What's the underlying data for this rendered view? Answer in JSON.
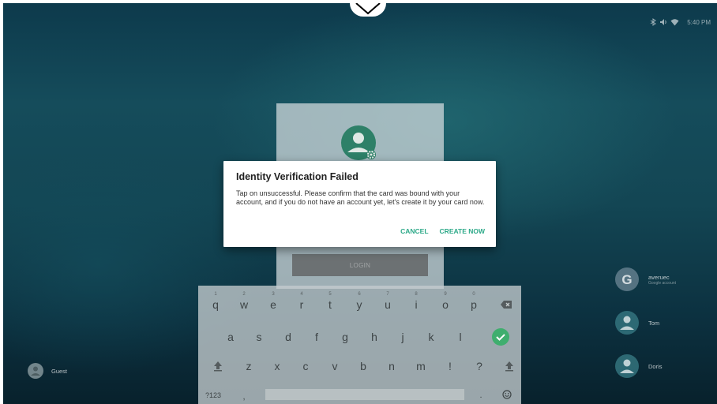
{
  "status_bar": {
    "time": "5:40 PM",
    "icons": [
      "bluetooth-icon",
      "volume-icon",
      "wifi-icon"
    ]
  },
  "login_card": {
    "login_label": "LOGIN"
  },
  "dialog": {
    "title": "Identity Verification Failed",
    "message": "Tap on unsuccessful. Please confirm that the card was bound with your account, and if you do not have an account yet, let's create it by your card now.",
    "cancel_label": "CANCEL",
    "create_label": "CREATE NOW"
  },
  "keyboard": {
    "row1": [
      "q",
      "w",
      "e",
      "r",
      "t",
      "y",
      "u",
      "i",
      "o",
      "p"
    ],
    "row1_hints": [
      "1",
      "2",
      "3",
      "4",
      "5",
      "6",
      "7",
      "8",
      "9",
      "0"
    ],
    "row2": [
      "a",
      "s",
      "d",
      "f",
      "g",
      "h",
      "j",
      "k",
      "l"
    ],
    "row3": [
      "z",
      "x",
      "c",
      "v",
      "b",
      "n",
      "m",
      "!",
      "?"
    ],
    "symbols_label": "?123",
    "comma_label": ",",
    "period_label": "."
  },
  "users": [
    {
      "name": "averuec",
      "subtitle": "Google account",
      "avatar": "google-icon"
    },
    {
      "name": "Tom",
      "avatar": "person-icon"
    },
    {
      "name": "Doris",
      "avatar": "person-icon"
    },
    {
      "name": "Guest",
      "avatar": "person-icon"
    }
  ],
  "colors": {
    "accent": "#2aa887",
    "dialog_bg": "#ffffff"
  }
}
